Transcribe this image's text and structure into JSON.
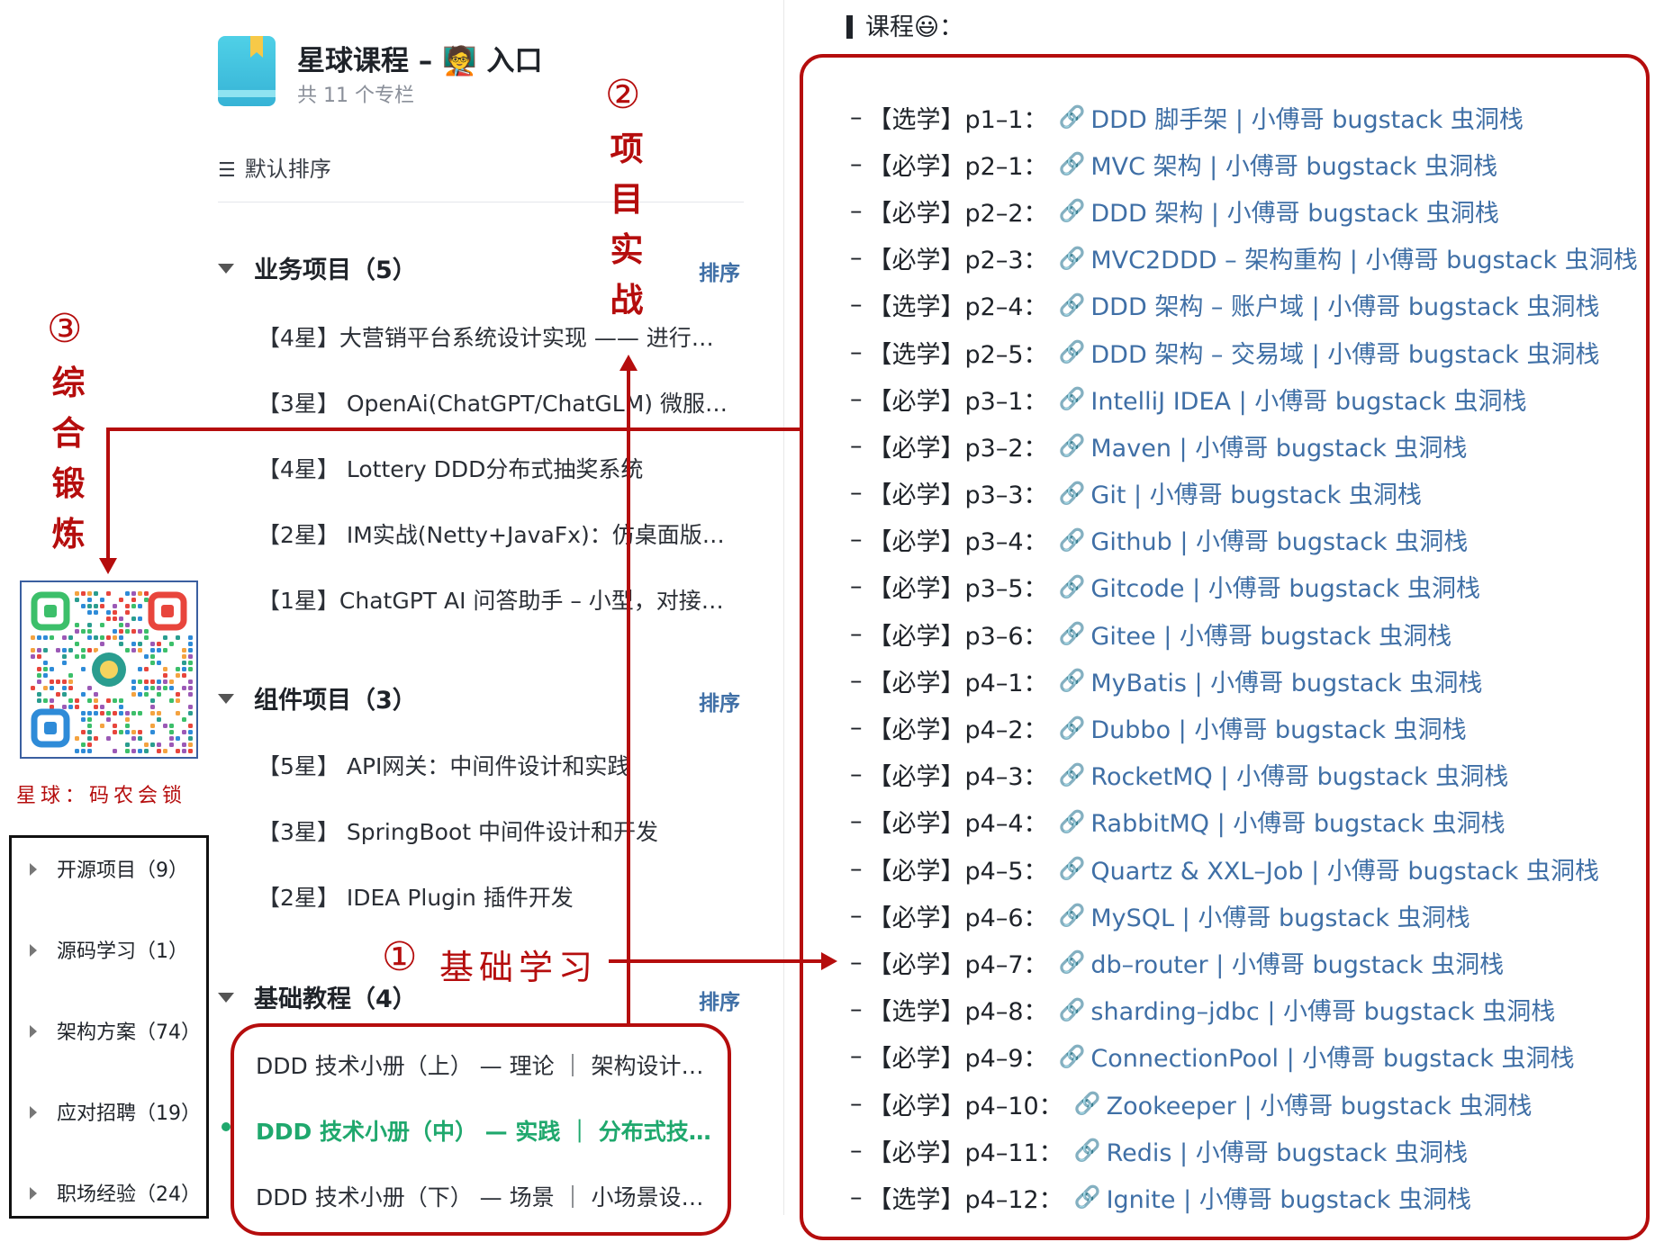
{
  "header": {
    "title": "星球课程 – 🧑‍🏫 入口",
    "subtitle": "共 11 个专栏",
    "sort_icon": "☰",
    "sort_label": "默认排序"
  },
  "sections": [
    {
      "title": "业务项目（5）",
      "sort_label": "排序",
      "items": [
        "【4星】大营销平台系统设计实现 —— 进行…",
        "【3星】 OpenAi(ChatGPT/ChatGLM) 微服…",
        "【4星】 Lottery DDD分布式抽奖系统",
        "【2星】 IM实战(Netty+JavaFx)：仿桌面版…",
        "【1星】ChatGPT AI 问答助手 – 小型，对接…"
      ]
    },
    {
      "title": "组件项目（3）",
      "sort_label": "排序",
      "items": [
        "【5星】 API网关：中间件设计和实践",
        "【3星】 SpringBoot 中间件设计和开发",
        "【2星】 IDEA Plugin 插件开发"
      ]
    },
    {
      "title": "基础教程（4）",
      "sort_label": "排序",
      "items": [
        "DDD 技术小册（上） — 理论 ｜ 架构设计…",
        "DDD 技术小册（中） — 实践 ｜ 分布式技…",
        "DDD 技术小册（下） — 场景 ｜ 小场景设…"
      ]
    }
  ],
  "categories": [
    "开源项目（9）",
    "源码学习（1）",
    "架构方案（74）",
    "应对招聘（19）",
    "职场经验（24）"
  ],
  "annotations": {
    "a1_num": "①",
    "a1_text": "基础学习",
    "a2_num": "②",
    "a2_chars": [
      "项",
      "目",
      "实",
      "战"
    ],
    "a3_num": "③",
    "a3_chars": [
      "综",
      "合",
      "锻",
      "炼"
    ],
    "qr_caption": "星球：码农会锁",
    "annotation_color": "#b50d0d"
  },
  "panel": {
    "heading": "课程😃：",
    "link_icon": "🔗",
    "link_color": "#3f6fa6",
    "courses": [
      {
        "tag": "【选学】",
        "code": "p1–1：",
        "text": "DDD 脚手架 | 小傅哥 bugstack 虫洞栈"
      },
      {
        "tag": "【必学】",
        "code": "p2–1：",
        "text": "MVC 架构 | 小傅哥 bugstack 虫洞栈"
      },
      {
        "tag": "【必学】",
        "code": "p2–2：",
        "text": "DDD 架构 | 小傅哥 bugstack 虫洞栈"
      },
      {
        "tag": "【必学】",
        "code": "p2–3：",
        "text": "MVC2DDD – 架构重构 | 小傅哥 bugstack 虫洞栈"
      },
      {
        "tag": "【选学】",
        "code": "p2–4：",
        "text": "DDD 架构 – 账户域 | 小傅哥 bugstack 虫洞栈"
      },
      {
        "tag": "【选学】",
        "code": "p2–5：",
        "text": "DDD 架构 – 交易域 | 小傅哥 bugstack 虫洞栈"
      },
      {
        "tag": "【必学】",
        "code": "p3–1：",
        "text": "IntelliJ IDEA | 小傅哥 bugstack 虫洞栈"
      },
      {
        "tag": "【必学】",
        "code": "p3–2：",
        "text": "Maven | 小傅哥 bugstack 虫洞栈"
      },
      {
        "tag": "【必学】",
        "code": "p3–3：",
        "text": "Git | 小傅哥 bugstack 虫洞栈"
      },
      {
        "tag": "【必学】",
        "code": "p3–4：",
        "text": "Github | 小傅哥 bugstack 虫洞栈"
      },
      {
        "tag": "【必学】",
        "code": "p3–5：",
        "text": "Gitcode | 小傅哥 bugstack 虫洞栈"
      },
      {
        "tag": "【必学】",
        "code": "p3–6：",
        "text": "Gitee | 小傅哥 bugstack 虫洞栈"
      },
      {
        "tag": "【必学】",
        "code": "p4–1：",
        "text": "MyBatis | 小傅哥 bugstack 虫洞栈"
      },
      {
        "tag": "【必学】",
        "code": "p4–2：",
        "text": "Dubbo | 小傅哥 bugstack 虫洞栈"
      },
      {
        "tag": "【必学】",
        "code": "p4–3：",
        "text": "RocketMQ | 小傅哥 bugstack 虫洞栈"
      },
      {
        "tag": "【必学】",
        "code": "p4–4：",
        "text": "RabbitMQ | 小傅哥 bugstack 虫洞栈"
      },
      {
        "tag": "【必学】",
        "code": "p4–5：",
        "text": "Quartz & XXL–Job | 小傅哥 bugstack 虫洞栈"
      },
      {
        "tag": "【必学】",
        "code": "p4–6：",
        "text": "MySQL | 小傅哥 bugstack 虫洞栈"
      },
      {
        "tag": "【必学】",
        "code": "p4–7：",
        "text": "db–router | 小傅哥 bugstack 虫洞栈"
      },
      {
        "tag": "【选学】",
        "code": "p4–8：",
        "text": "sharding–jdbc | 小傅哥 bugstack 虫洞栈"
      },
      {
        "tag": "【必学】",
        "code": "p4–9：",
        "text": "ConnectionPool | 小傅哥 bugstack 虫洞栈"
      },
      {
        "tag": "【必学】",
        "code": "p4–10：",
        "text": "Zookeeper | 小傅哥 bugstack 虫洞栈"
      },
      {
        "tag": "【必学】",
        "code": "p4–11：",
        "text": "Redis | 小傅哥 bugstack 虫洞栈"
      },
      {
        "tag": "【选学】",
        "code": "p4–12：",
        "text": "Ignite | 小傅哥 bugstack 虫洞栈"
      }
    ]
  }
}
